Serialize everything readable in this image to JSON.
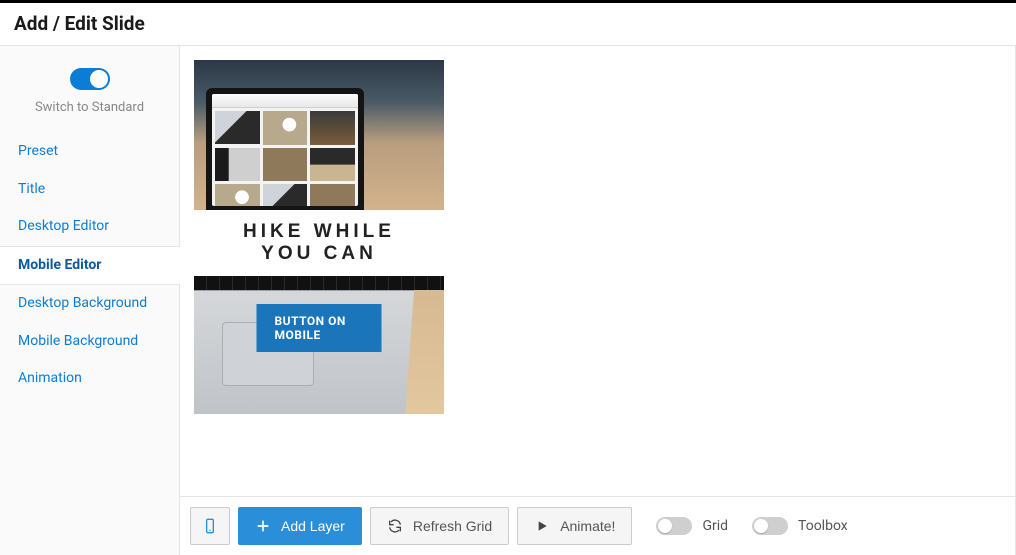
{
  "header": {
    "title": "Add / Edit Slide"
  },
  "sidebar": {
    "toggle_label": "Switch to Standard",
    "toggle_on": true,
    "items": [
      {
        "label": "Preset"
      },
      {
        "label": "Title"
      },
      {
        "label": "Desktop Editor"
      },
      {
        "label": "Mobile Editor",
        "active": true
      },
      {
        "label": "Desktop Background"
      },
      {
        "label": "Mobile Background"
      },
      {
        "label": "Animation"
      }
    ]
  },
  "preview": {
    "headline": "HIKE WHILE\nYOU CAN",
    "cta_label": "BUTTON ON MOBILE"
  },
  "toolbar": {
    "device_icon": "mobile",
    "add_layer_label": "Add Layer",
    "refresh_label": "Refresh Grid",
    "animate_label": "Animate!",
    "grid_label": "Grid",
    "grid_on": false,
    "toolbox_label": "Toolbox",
    "toolbox_on": false
  }
}
